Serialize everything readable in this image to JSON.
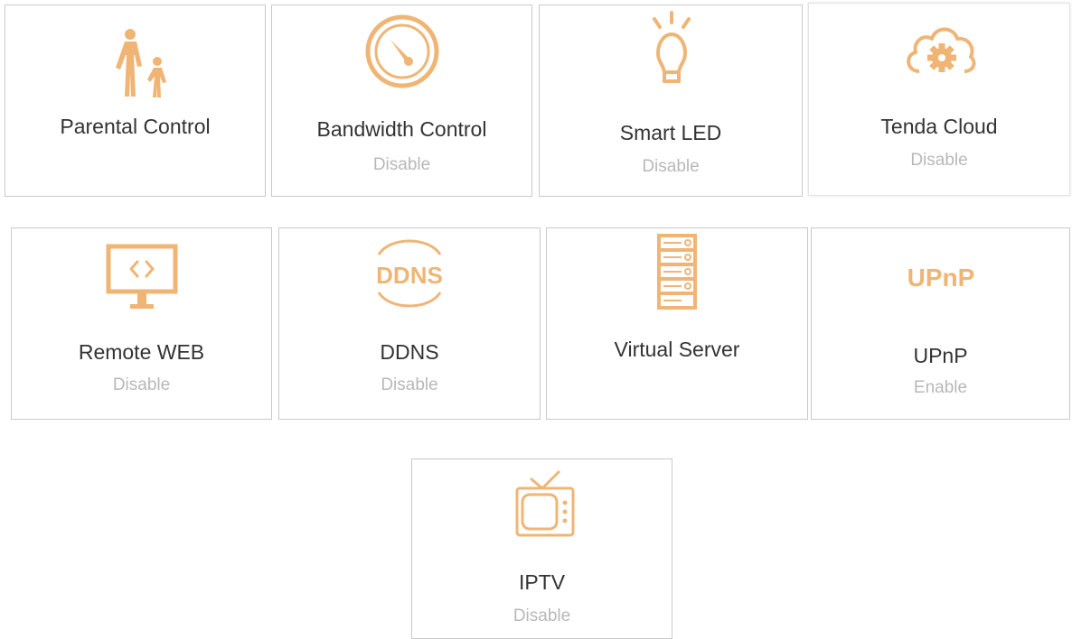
{
  "accent_color": "#f0b575",
  "tiles": [
    {
      "name": "Parental Control",
      "status": "",
      "icon": "parent-child-icon"
    },
    {
      "name": "Bandwidth Control",
      "status": "Disable",
      "icon": "speedometer-icon"
    },
    {
      "name": "Smart LED",
      "status": "Disable",
      "icon": "lightbulb-icon"
    },
    {
      "name": "Tenda Cloud",
      "status": "Disable",
      "icon": "cloud-gear-icon"
    },
    {
      "name": "Remote WEB",
      "status": "Disable",
      "icon": "monitor-code-icon"
    },
    {
      "name": "DDNS",
      "status": "Disable",
      "icon": "ddns-icon",
      "icon_text": "DDNS"
    },
    {
      "name": "Virtual Server",
      "status": "",
      "icon": "server-rack-icon"
    },
    {
      "name": "UPnP",
      "status": "Enable",
      "icon": "upnp-icon",
      "icon_text": "UPnP"
    },
    {
      "name": "IPTV",
      "status": "Disable",
      "icon": "tv-icon"
    }
  ]
}
